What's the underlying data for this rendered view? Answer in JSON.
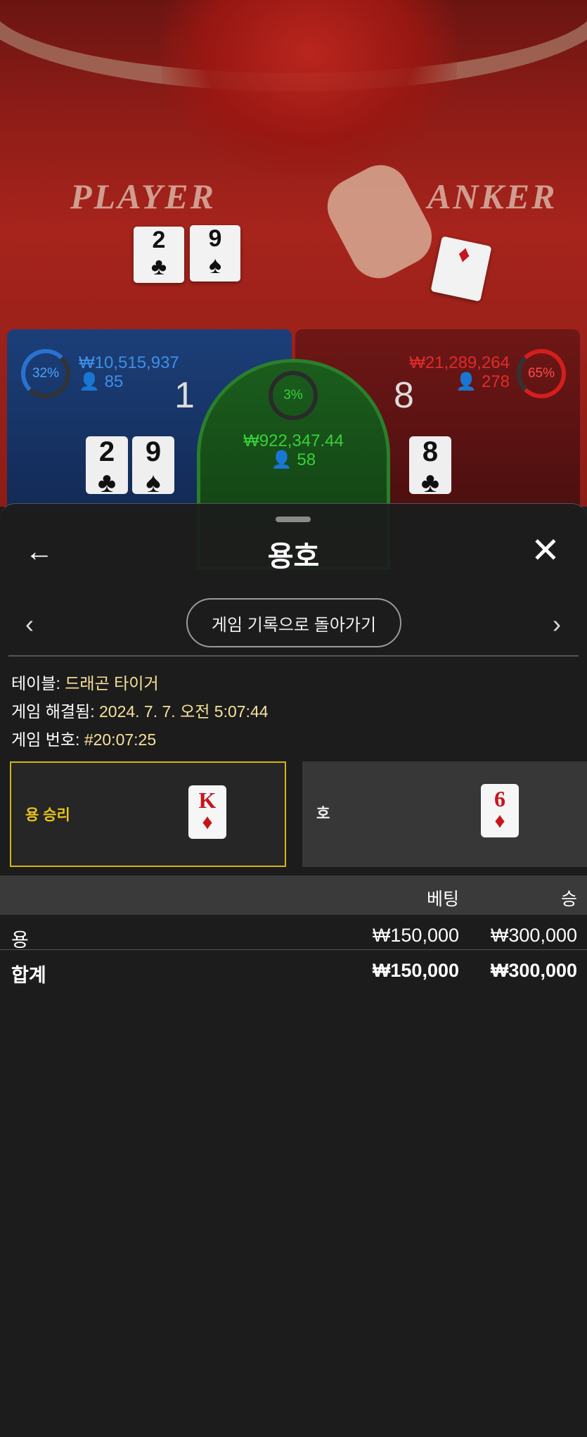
{
  "scene": {
    "player_word": "PLAYER",
    "banker_word": "ANKER"
  },
  "stats": {
    "player": {
      "percent": "32%",
      "amount": "₩10,515,937",
      "players": "85",
      "score": "1",
      "cards": [
        "2",
        "9"
      ]
    },
    "tie": {
      "percent": "3%",
      "amount": "₩922,347.44",
      "players": "58"
    },
    "banker": {
      "percent": "65%",
      "amount": "₩21,289,264",
      "players": "278",
      "score": "8",
      "cards": [
        "8"
      ]
    }
  },
  "modal": {
    "title": "용호",
    "back_icon": "arrow-left-icon",
    "close_icon": "close-icon",
    "history_button": "게임 기록으로 돌아가기",
    "info": {
      "table_label": "테이블: ",
      "table_value": "드래곤 타이거",
      "resolved_label": "게임 해결됨: ",
      "resolved_value": "2024. 7. 7. 오전 5:07:44",
      "number_label": "게임 번호: ",
      "number_value": "#20:07:25"
    },
    "results": {
      "dragon": {
        "label": "용 승리",
        "card_rank": "K",
        "card_suit": "♦"
      },
      "tiger": {
        "label": "호",
        "card_rank": "6",
        "card_suit": "♦"
      }
    },
    "table": {
      "headers": {
        "bet": "베팅",
        "win": "승"
      },
      "rows": [
        {
          "name": "용",
          "bet": "₩150,000",
          "win": "₩300,000"
        }
      ],
      "total": {
        "name": "합계",
        "bet": "₩150,000",
        "win": "₩300,000"
      }
    }
  },
  "colors": {
    "accent_gold": "#d4b419",
    "player_blue": "#1c3f79",
    "banker_red": "#6e1716",
    "tie_green": "#1b5d1d",
    "value_yellow": "#f7e19a"
  }
}
